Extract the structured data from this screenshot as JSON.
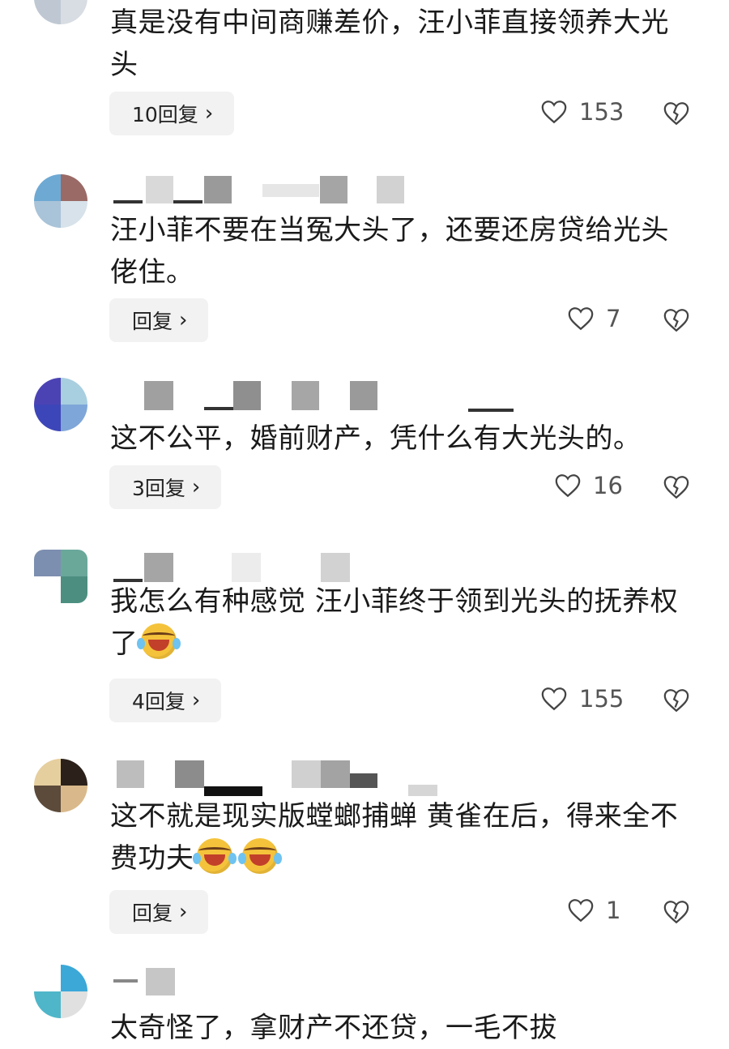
{
  "comments": [
    {
      "text": "真是没有中间商赚差价，汪小菲直接领养大光头",
      "reply_label": "10回复",
      "likes": "153"
    },
    {
      "text": "汪小菲不要在当冤大头了，还要还房贷给光头佬住。",
      "reply_label": "回复",
      "likes": "7"
    },
    {
      "text": "这不公平，婚前财产，凭什么有大光头的。",
      "reply_label": "3回复",
      "likes": "16"
    },
    {
      "text": "我怎么有种感觉 汪小菲终于领到光头的抚养权了",
      "reply_label": "4回复",
      "likes": "155"
    },
    {
      "text": "这不就是现实版螳螂捕蝉 黄雀在后，得来全不费功夫",
      "reply_label": "回复",
      "likes": "1"
    },
    {
      "text": "太奇怪了，拿财产不还贷，一毛不拔"
    }
  ],
  "icons": {
    "like": "heart-outline-icon",
    "dislike": "broken-heart-icon",
    "chevron": "chevron-right-icon",
    "emoji": "laughing-crying-emoji"
  },
  "colors": {
    "reply_bg": "#f2f2f2",
    "text": "#1a1a1a",
    "muted": "#555555"
  }
}
